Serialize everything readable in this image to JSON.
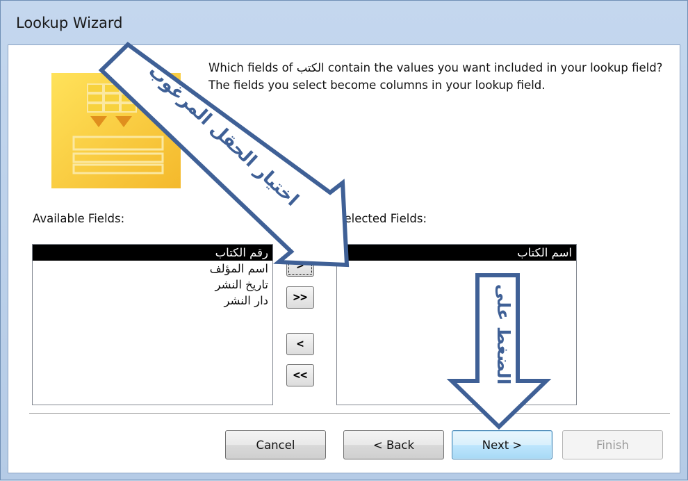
{
  "window": {
    "title": "Lookup Wizard"
  },
  "prompt": {
    "text": "Which fields of الكتب contain the values you want included in your lookup field? The fields you select become columns in your lookup field."
  },
  "available": {
    "label": "Available Fields:",
    "items": [
      "رقم الكتاب",
      "اسم المؤلف",
      "تاريخ النشر",
      "دار النشر"
    ],
    "selected_index": 0
  },
  "selected": {
    "label": "Selected Fields:",
    "items": [
      "اسم الكتاب"
    ],
    "selected_index": 0
  },
  "move_buttons": {
    "add_one": ">",
    "add_all": ">>",
    "remove_one": "<",
    "remove_all": "<<"
  },
  "footer": {
    "cancel": "Cancel",
    "back": "< Back",
    "next": "Next >",
    "finish": "Finish"
  },
  "annotations": {
    "diagonal_arrow_text": "اختيار الحقل المرغوب",
    "down_arrow_text": "الضغط على",
    "arrow_color": "#3f6096"
  }
}
